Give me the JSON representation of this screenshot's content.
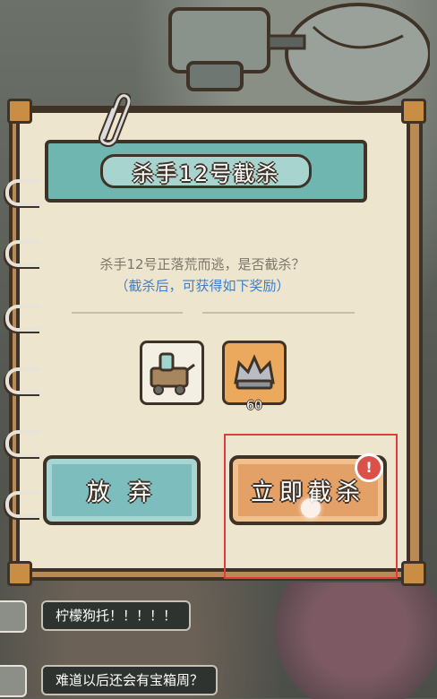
{
  "dialog": {
    "title": "杀手12号截杀",
    "question": "杀手12号正落荒而逃，是否截杀？",
    "hint": "（截杀后，可获得如下奖励）",
    "rewards": [
      {
        "icon": "cart-icon",
        "count": ""
      },
      {
        "icon": "treasure-crown-icon",
        "count": "60"
      }
    ],
    "buttons": {
      "give_up": "放 弃",
      "intercept": "立即截杀"
    },
    "alert_symbol": "!"
  },
  "chat": [
    {
      "text": "柠檬狗托！！！！！"
    },
    {
      "text": "难道以后还会有宝箱周？"
    }
  ],
  "colors": {
    "title_banner": "#6fb5b0",
    "give_up_button": "#7dbdbe",
    "intercept_button": "#e3a067",
    "hint_text": "#3e7fc4",
    "highlight_box": "#e33b3b"
  }
}
